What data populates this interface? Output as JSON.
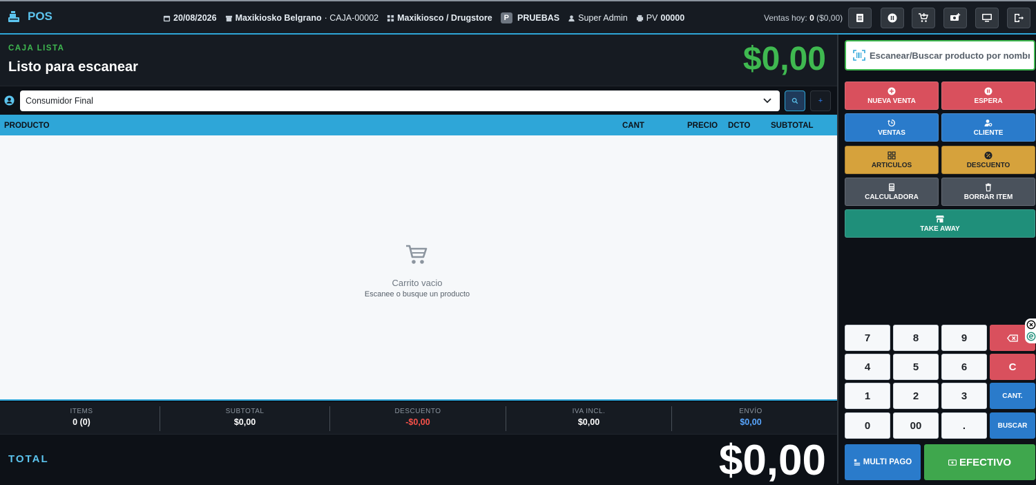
{
  "header": {
    "brand": "POS",
    "date": "20/08/2026",
    "store": "Maxikiosko Belgrano",
    "caja": "· CAJA-00002",
    "category": "Maxikiosco / Drugstore",
    "env_badge": "P",
    "env_label": "PRUEBAS",
    "user": "Super Admin",
    "pv_label": "PV",
    "pv_number": "00000",
    "ventas_hoy_label": "Ventas hoy:",
    "ventas_hoy_count": "0",
    "ventas_hoy_amount": "($0,00)"
  },
  "status": {
    "label": "CAJA LISTA",
    "title": "Listo para escanear",
    "amount": "$0,00"
  },
  "customer": {
    "selected": "Consumidor Final",
    "search_btn": "🔍",
    "add_btn": "+"
  },
  "table": {
    "columns": [
      "PRODUCTO",
      "CANT",
      "PRECIO",
      "DCTO",
      "SUBTOTAL"
    ]
  },
  "cart": {
    "empty_title": "Carrito vacio",
    "empty_hint": "Escanee o busque un producto"
  },
  "summary": [
    {
      "key": "ITEMS",
      "value": "0 (0)",
      "color": "#ffffff"
    },
    {
      "key": "SUBTOTAL",
      "value": "$0,00",
      "color": "#ffffff"
    },
    {
      "key": "DESCUENTO",
      "value": "-$0,00",
      "color": "#f85149"
    },
    {
      "key": "IVA INCL.",
      "value": "$0,00",
      "color": "#ffffff"
    },
    {
      "key": "ENVÍO",
      "value": "$0,00",
      "color": "#58a6ff"
    }
  ],
  "total": {
    "label": "TOTAL",
    "value": "$0,00"
  },
  "search": {
    "placeholder": "Escanear/Buscar producto por nombre"
  },
  "actions": {
    "nueva_venta": "NUEVA VENTA",
    "espera": "ESPERA",
    "ventas": "VENTAS",
    "cliente": "CLIENTE",
    "articulos": "ARTICULOS",
    "descuento": "DESCUENTO",
    "calculadora": "CALCULADORA",
    "borrar_item": "BORRAR ITEM",
    "take_away": "TAKE AWAY"
  },
  "keypad": {
    "k7": "7",
    "k8": "8",
    "k9": "9",
    "k4": "4",
    "k5": "5",
    "k6": "6",
    "clear": "C",
    "k1": "1",
    "k2": "2",
    "k3": "3",
    "cant": "CANT.",
    "k0": "0",
    "k00": "00",
    "dot": ".",
    "buscar": "BUSCAR"
  },
  "payment": {
    "multi": "MULTI PAGO",
    "efectivo": "EFECTIVO"
  },
  "colors": {
    "accent": "#2ea6d8",
    "success": "#3fb950",
    "danger": "#d9505d",
    "primary": "#2a7bcb",
    "warning": "#d6a23c"
  }
}
